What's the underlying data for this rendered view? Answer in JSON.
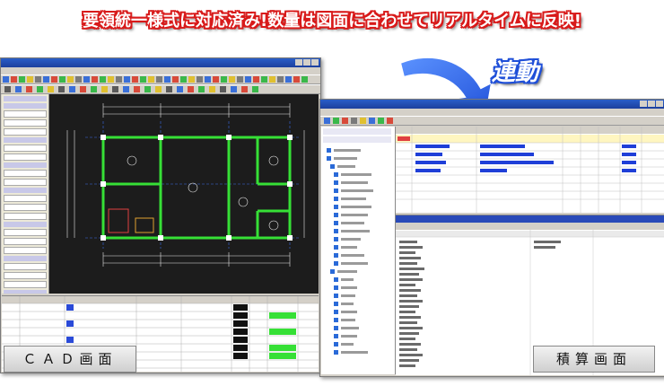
{
  "headline": "要領統一様式に対応済み!数量は図面に合わせてリアルタイムに反映!",
  "link_label": "連動",
  "cad_label": "ＣＡＤ画面",
  "estimation_label": "積算画面",
  "colors": {
    "headline_outline": "#d81a1a",
    "link_outline": "#1f4fd8",
    "arrow_fill": "#1f63e0",
    "cad_background": "#1c1c1c",
    "cad_wall": "#36e036"
  },
  "icons": {
    "arrow": "curved-arrow-icon"
  }
}
